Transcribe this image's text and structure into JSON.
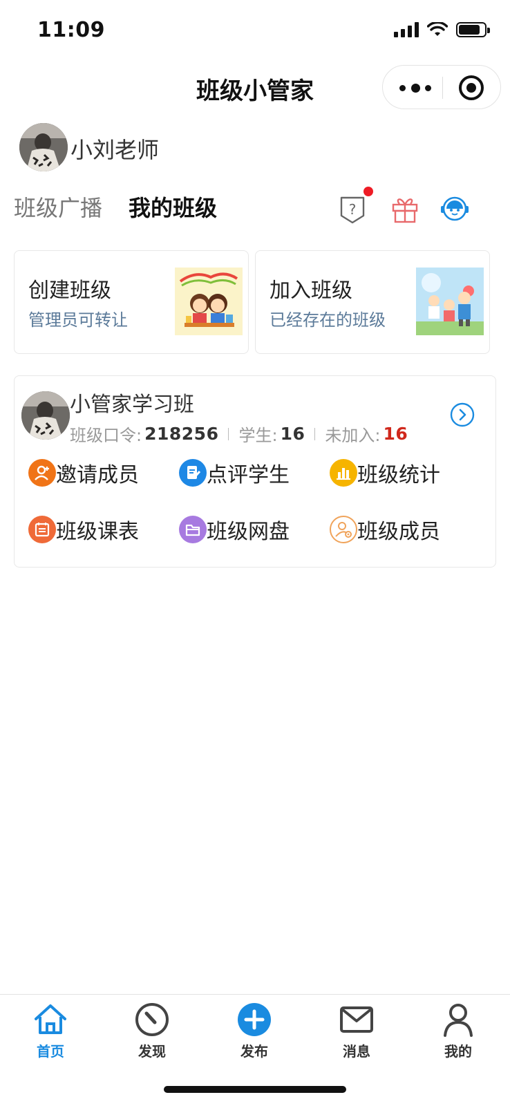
{
  "status_bar": {
    "time": "11:09"
  },
  "nav": {
    "title": "班级小管家"
  },
  "user": {
    "name": "小刘老师"
  },
  "tabs": [
    {
      "label": "班级广播",
      "active": false
    },
    {
      "label": "我的班级",
      "active": true
    }
  ],
  "top_icons": [
    "help-icon",
    "gift-icon",
    "customer-service-icon"
  ],
  "quick_actions": [
    {
      "title": "创建班级",
      "subtitle": "管理员可转让"
    },
    {
      "title": "加入班级",
      "subtitle": "已经存在的班级"
    }
  ],
  "class": {
    "name": "小管家学习班",
    "code_label": "班级口令:",
    "code": "218256",
    "students_label": "学生:",
    "students": "16",
    "not_joined_label": "未加入:",
    "not_joined": "16",
    "features": [
      {
        "label": "邀请成员",
        "icon": "invite-member-icon",
        "color": "#f07417"
      },
      {
        "label": "点评学生",
        "icon": "review-student-icon",
        "color": "#1e88e5"
      },
      {
        "label": "班级统计",
        "icon": "class-stats-icon",
        "color": "#f6b400"
      },
      {
        "label": "班级课表",
        "icon": "class-schedule-icon",
        "color": "#ef6a38"
      },
      {
        "label": "班级网盘",
        "icon": "class-drive-icon",
        "color": "#a77ae0"
      },
      {
        "label": "班级成员",
        "icon": "class-members-icon",
        "color": "#f0a35a"
      }
    ]
  },
  "tabbar": [
    {
      "label": "首页",
      "icon": "home-icon",
      "active": true
    },
    {
      "label": "发现",
      "icon": "compass-icon",
      "active": false
    },
    {
      "label": "发布",
      "icon": "plus-circle-icon",
      "active": false
    },
    {
      "label": "消息",
      "icon": "mail-icon",
      "active": false
    },
    {
      "label": "我的",
      "icon": "user-icon",
      "active": false
    }
  ],
  "colors": {
    "accent": "#1a8be0",
    "alert_red": "#d0281c",
    "subtitle": "#5b7a99"
  }
}
